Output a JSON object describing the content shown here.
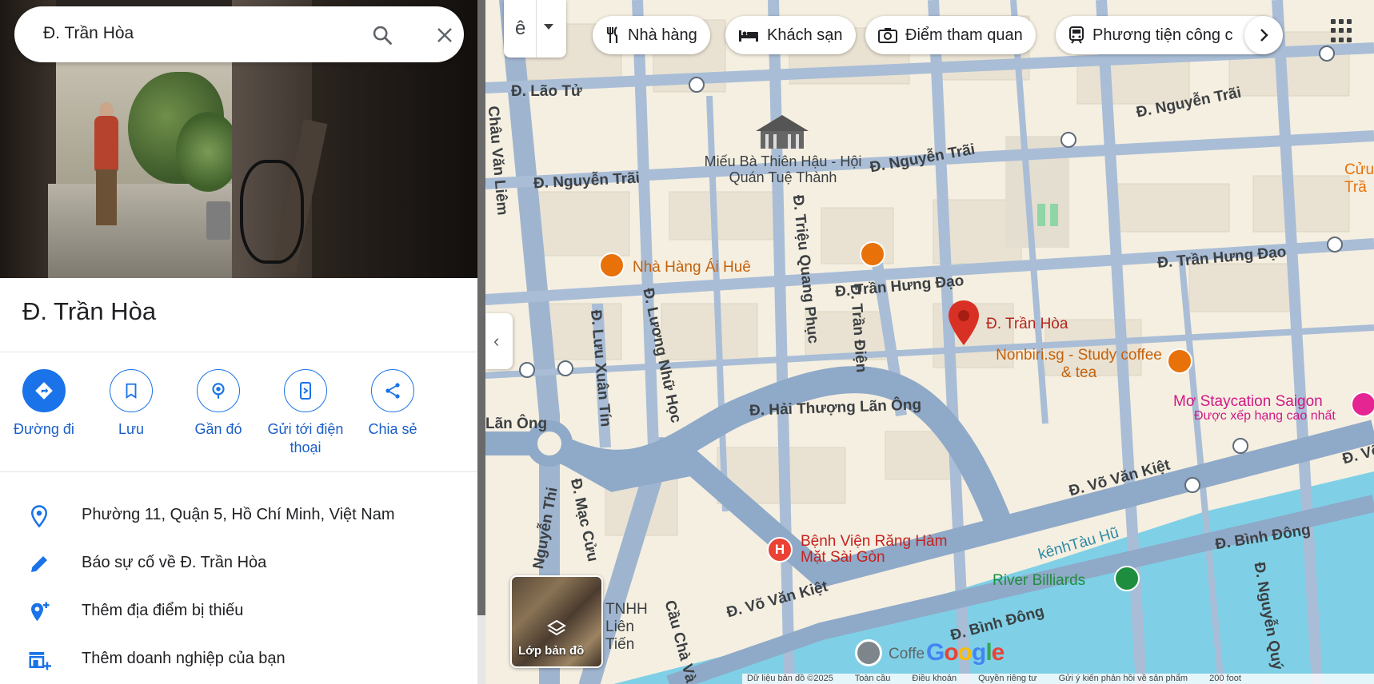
{
  "search": {
    "query": "Đ. Trần Hòa"
  },
  "place": {
    "title": "Đ. Trần Hòa"
  },
  "actions": [
    {
      "label": "Đường đi"
    },
    {
      "label": "Lưu"
    },
    {
      "label": "Gần đó"
    },
    {
      "label": "Gửi tới điện thoại"
    },
    {
      "label": "Chia sẻ"
    }
  ],
  "info_rows": [
    {
      "text": "Phường 11, Quận 5, Hồ Chí Minh, Việt Nam",
      "icon": "location-pin-icon"
    },
    {
      "text": "Báo sự cố về Đ. Trần Hòa",
      "icon": "pencil-icon"
    },
    {
      "text": "Thêm địa điểm bị thiếu",
      "icon": "add-location-icon"
    },
    {
      "text": "Thêm doanh nghiệp của bạn",
      "icon": "add-business-icon"
    }
  ],
  "map": {
    "lang_char": "ê",
    "chips": [
      "Nhà hàng",
      "Khách sạn",
      "Điểm tham quan",
      "Phương tiện công c"
    ],
    "layers_label": "Lớp bản đồ",
    "google_logo": "Google",
    "attribution": [
      "Dữ liệu bản đồ ©2025",
      "Toàn cầu",
      "Điều khoản",
      "Quyền riêng tư",
      "Gửi ý kiến phản hồi về sản phẩm",
      "200 foot"
    ],
    "streets": [
      "Đ. Lão Tử",
      "Đ. Nguyễn Trãi",
      "Đ. Nguyễn Trãi",
      "Đ. Nguyễn Trãi",
      "Châu Văn Liêm",
      "Đ. Triệu Quang Phục",
      "Đ. Trần Hưng Đạo",
      "Đ. Trần Hưng Đạo",
      "Đ. Lương Nhữ Học",
      "Đ. Lưu Xuân Tín",
      "Đ. Trần Điện",
      "Đ. Hải Thượng Lãn Ông",
      "Lãn Ông",
      "Đ. Võ Văn Kiệt",
      "Đ. Võ Văn Kiệt",
      "Đ. Võ Văn Kiệt",
      "Đ. Bình Đông",
      "Đ. Bình Đông",
      "Đ. Mạc Cửu",
      "Nguyễn Thi",
      "Cầu Chà Và",
      "kênhTàu Hũ",
      "Đ. Nguyễn Quý"
    ],
    "pois": {
      "temple": "Miếu Bà Thiên Hậu - Hội Quán Tuệ Thành",
      "restaurant": "Nhà Hàng Ái Huê",
      "pin": "Đ. Trần Hòa",
      "cafe": "Nonbiri.sg - Study coffee & tea",
      "staycation": "Mơ Staycation Saigon",
      "staycation_sub": "Được xếp hạng cao nhất",
      "hospital": "Bệnh Viện Răng Hàm Mặt Sài Gòn",
      "billiards": "River Billiards",
      "company": "TNHH Liên Tiến",
      "coffee": "Coffe",
      "cut_right": "Cửu Trầ"
    }
  },
  "colors": {
    "accent": "#1a73e8",
    "pin": "#d93025",
    "poi_orange": "#e8710a",
    "water": "#7fd0e6",
    "road": "#8fa9c8"
  }
}
